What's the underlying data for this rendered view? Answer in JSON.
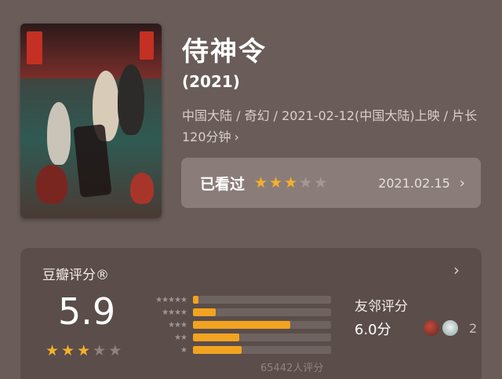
{
  "movie": {
    "title": "侍神令",
    "year": "(2021)",
    "meta": "中国大陆 / 奇幻 / 2021-02-12(中国大陆)上映 / 片长120分钟",
    "poster_title": "侍神令"
  },
  "watched": {
    "label": "已看过",
    "stars": 3,
    "max_stars": 5,
    "date": "2021.02.15"
  },
  "rating": {
    "title": "豆瓣评分®",
    "score": "5.9",
    "stars": 3,
    "max_stars": 5,
    "distribution_percent": [
      2.5,
      10.3,
      44.2,
      21.0,
      22.0
    ],
    "count": "65442人评分",
    "friends": {
      "label": "友邻评分",
      "score": "6.0分",
      "count": "2"
    }
  },
  "colors": {
    "background": "#6a5d59",
    "star_on": "#f5b02b",
    "bar_fill": "#f2a320"
  },
  "icons": {
    "chevron": "chevron-right-icon",
    "star": "star-icon"
  }
}
